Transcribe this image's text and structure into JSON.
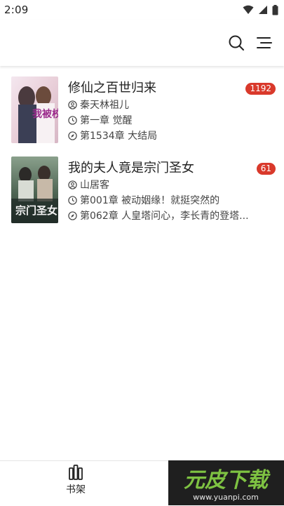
{
  "status_bar": {
    "time": "2:09"
  },
  "books": [
    {
      "title": "修仙之百世归来",
      "author": "秦天林祖儿",
      "read_chapter": "第一章 觉醒",
      "latest_chapter": "第1534章 大结局",
      "badge": "1192",
      "cover_text": "我被校花"
    },
    {
      "title": "我的夫人竟是宗门圣女",
      "author": "山居客",
      "read_chapter": "第001章 被动姻缘！就挺突然的",
      "latest_chapter": "第062章 人皇塔问心，李长青的登塔...",
      "badge": "61",
      "cover_text": "宗门圣女"
    }
  ],
  "bottom_nav": {
    "tabs": [
      {
        "label": "书架"
      }
    ]
  },
  "watermark": {
    "brand": "元皮下载",
    "url": "www.yuanpi.com"
  },
  "colors": {
    "badge": "#d9392b",
    "text": "#222222"
  }
}
